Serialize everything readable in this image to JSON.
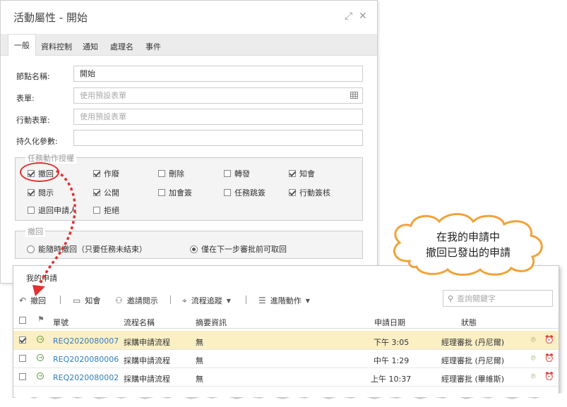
{
  "dialog": {
    "title": "活動屬性 - 開始",
    "tabs": [
      "一般",
      "資料控制",
      "通知",
      "處理名",
      "事件"
    ],
    "fields": {
      "node_name_label": "節點名稱:",
      "node_name_value": "開始",
      "form_label": "表單:",
      "form_placeholder": "使用預設表單",
      "mobile_form_label": "行動表單:",
      "mobile_form_placeholder": "使用預設表單",
      "persist_label": "持久化參數:",
      "persist_value": ""
    },
    "task_auth": {
      "legend": "任務動作授權",
      "items": [
        {
          "label": "撤回",
          "checked": true
        },
        {
          "label": "作廢",
          "checked": true
        },
        {
          "label": "刪除",
          "checked": false
        },
        {
          "label": "轉發",
          "checked": false
        },
        {
          "label": "知會",
          "checked": true
        },
        {
          "label": "閱示",
          "checked": true
        },
        {
          "label": "公開",
          "checked": true
        },
        {
          "label": "加會簽",
          "checked": false
        },
        {
          "label": "任務跳簽",
          "checked": false
        },
        {
          "label": "行動簽核",
          "checked": true
        },
        {
          "label": "退回申請人",
          "checked": false
        },
        {
          "label": "拒絕",
          "checked": false
        }
      ]
    },
    "withdraw": {
      "legend": "撤回",
      "option1": "能隨時撤回（只要任務未結束）",
      "option2": "僅在下一步審批前可取回",
      "selected": 2
    }
  },
  "callout": {
    "line1": "在我的申請中",
    "line2": "撤回已發出的申請"
  },
  "list": {
    "title": "我的申請",
    "toolbar": {
      "withdraw": "撤回",
      "notify": "知會",
      "invite": "邀請閱示",
      "trace": "流程追蹤",
      "advanced": "進階動作"
    },
    "search_placeholder": "查詢關鍵字",
    "headers": {
      "number": "單號",
      "process": "流程名稱",
      "summary": "摘要資訊",
      "date": "申請日期",
      "status": "狀態"
    },
    "rows": [
      {
        "number": "REQ2020080007",
        "process": "採購申請流程",
        "summary": "無",
        "date": "下午 3:05",
        "status": "經理審批 (丹尼爾)",
        "checked": true
      },
      {
        "number": "REQ2020080006",
        "process": "採購申請流程",
        "summary": "無",
        "date": "中午 1:29",
        "status": "經理審批 (丹尼爾)",
        "checked": false
      },
      {
        "number": "REQ2020080002",
        "process": "採購申請流程",
        "summary": "無",
        "date": "上午 10:37",
        "status": "經理審批 (畢維斯)",
        "checked": false
      }
    ]
  },
  "colors": {
    "highlight_red": "#e43030",
    "selected_row": "#fbefc4",
    "link_blue": "#2f7fbf"
  }
}
